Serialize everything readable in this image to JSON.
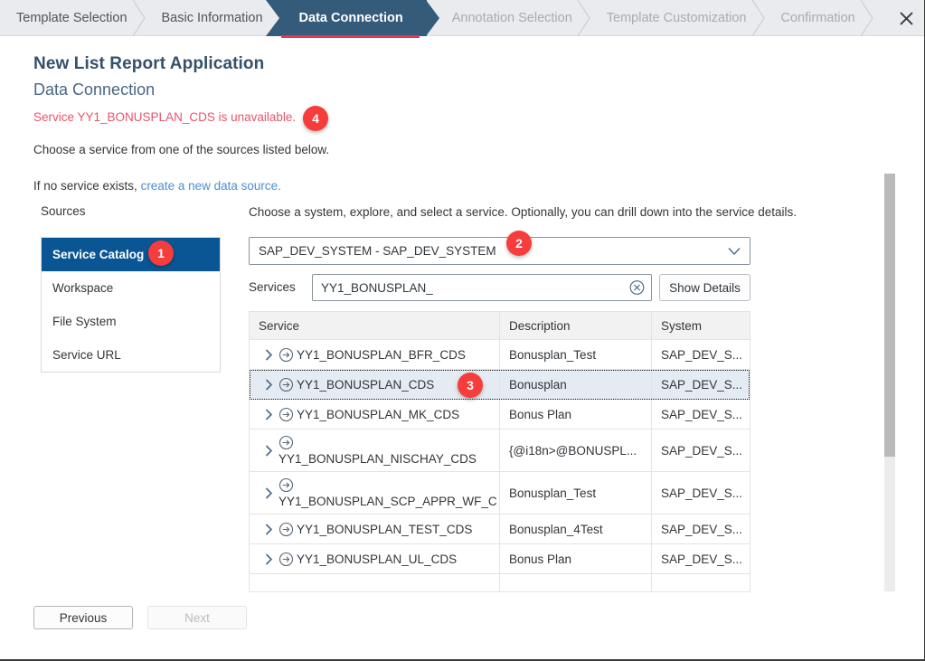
{
  "wizard": {
    "steps": [
      {
        "label": "Template Selection",
        "state": "done"
      },
      {
        "label": "Basic Information",
        "state": "done"
      },
      {
        "label": "Data Connection",
        "state": "active"
      },
      {
        "label": "Annotation Selection",
        "state": "future"
      },
      {
        "label": "Template Customization",
        "state": "future"
      },
      {
        "label": "Confirmation",
        "state": "future"
      }
    ],
    "close_icon": "close-icon",
    "active_underline_color": "#e8374f",
    "active_tab_color": "#355b7b"
  },
  "header": {
    "title": "New List Report Application",
    "subtitle": "Data Connection",
    "error_message": "Service YY1_BONUSPLAN_CDS is unavailable.",
    "error_color": "#e8546a",
    "instruction": "Choose a service from one of the sources listed below.",
    "no_service_prefix": "If no service exists,",
    "create_link": "create a new data source.",
    "link_color": "#4b8fd0"
  },
  "sources": {
    "label": "Sources",
    "selected_color": "#0a5694",
    "items": [
      {
        "label": "Service Catalog",
        "selected": true
      },
      {
        "label": "Workspace",
        "selected": false
      },
      {
        "label": "File System",
        "selected": false
      },
      {
        "label": "Service URL",
        "selected": false
      }
    ]
  },
  "main": {
    "choose_text": "Choose a system, explore, and select a service. Optionally, you can drill down into the service details.",
    "system_select": {
      "value": "SAP_DEV_SYSTEM - SAP_DEV_SYSTEM",
      "caret_icon": "chevron-down-icon"
    },
    "services_field": {
      "label": "Services",
      "value": "YY1_BONUSPLAN_",
      "placeholder": "",
      "clear_icon": "clear-circle-icon"
    },
    "show_details_button": "Show Details"
  },
  "table": {
    "columns": [
      "Service",
      "Description",
      "System"
    ],
    "rows": [
      {
        "service": "YY1_BONUSPLAN_BFR_CDS",
        "description": "Bonusplan_Test",
        "system": "SAP_DEV_S...",
        "selected": false,
        "wrapped": false
      },
      {
        "service": "YY1_BONUSPLAN_CDS",
        "description": "Bonusplan",
        "system": "SAP_DEV_S...",
        "selected": true,
        "wrapped": false
      },
      {
        "service": "YY1_BONUSPLAN_MK_CDS",
        "description": "Bonus Plan",
        "system": "SAP_DEV_S...",
        "selected": false,
        "wrapped": false
      },
      {
        "service": "YY1_BONUSPLAN_NISCHAY_CDS",
        "description": "{@i18n>@BONUSPL...",
        "system": "SAP_DEV_S...",
        "selected": false,
        "wrapped": true
      },
      {
        "service": "YY1_BONUSPLAN_SCP_APPR_WF_C",
        "description": "Bonusplan_Test",
        "system": "SAP_DEV_S...",
        "selected": false,
        "wrapped": true
      },
      {
        "service": "YY1_BONUSPLAN_TEST_CDS",
        "description": "Bonusplan_4Test",
        "system": "SAP_DEV_S...",
        "selected": false,
        "wrapped": false
      },
      {
        "service": "YY1_BONUSPLAN_UL_CDS",
        "description": "Bonus Plan",
        "system": "SAP_DEV_S...",
        "selected": false,
        "wrapped": false
      },
      {
        "service": "",
        "description": "",
        "system": "",
        "selected": false,
        "wrapped": false
      }
    ],
    "row_icon": "service-arrow-icon",
    "expander_icon": "chevron-right-icon",
    "selected_row_color": "#e5ebf2"
  },
  "footer": {
    "previous_label": "Previous",
    "next_label": "Next",
    "next_disabled": true
  },
  "badges": [
    {
      "number": "1",
      "target": "service-catalog-source"
    },
    {
      "number": "2",
      "target": "system-select"
    },
    {
      "number": "3",
      "target": "selected-service-row"
    },
    {
      "number": "4",
      "target": "error-message"
    }
  ],
  "badge_color": "#f73c3c"
}
